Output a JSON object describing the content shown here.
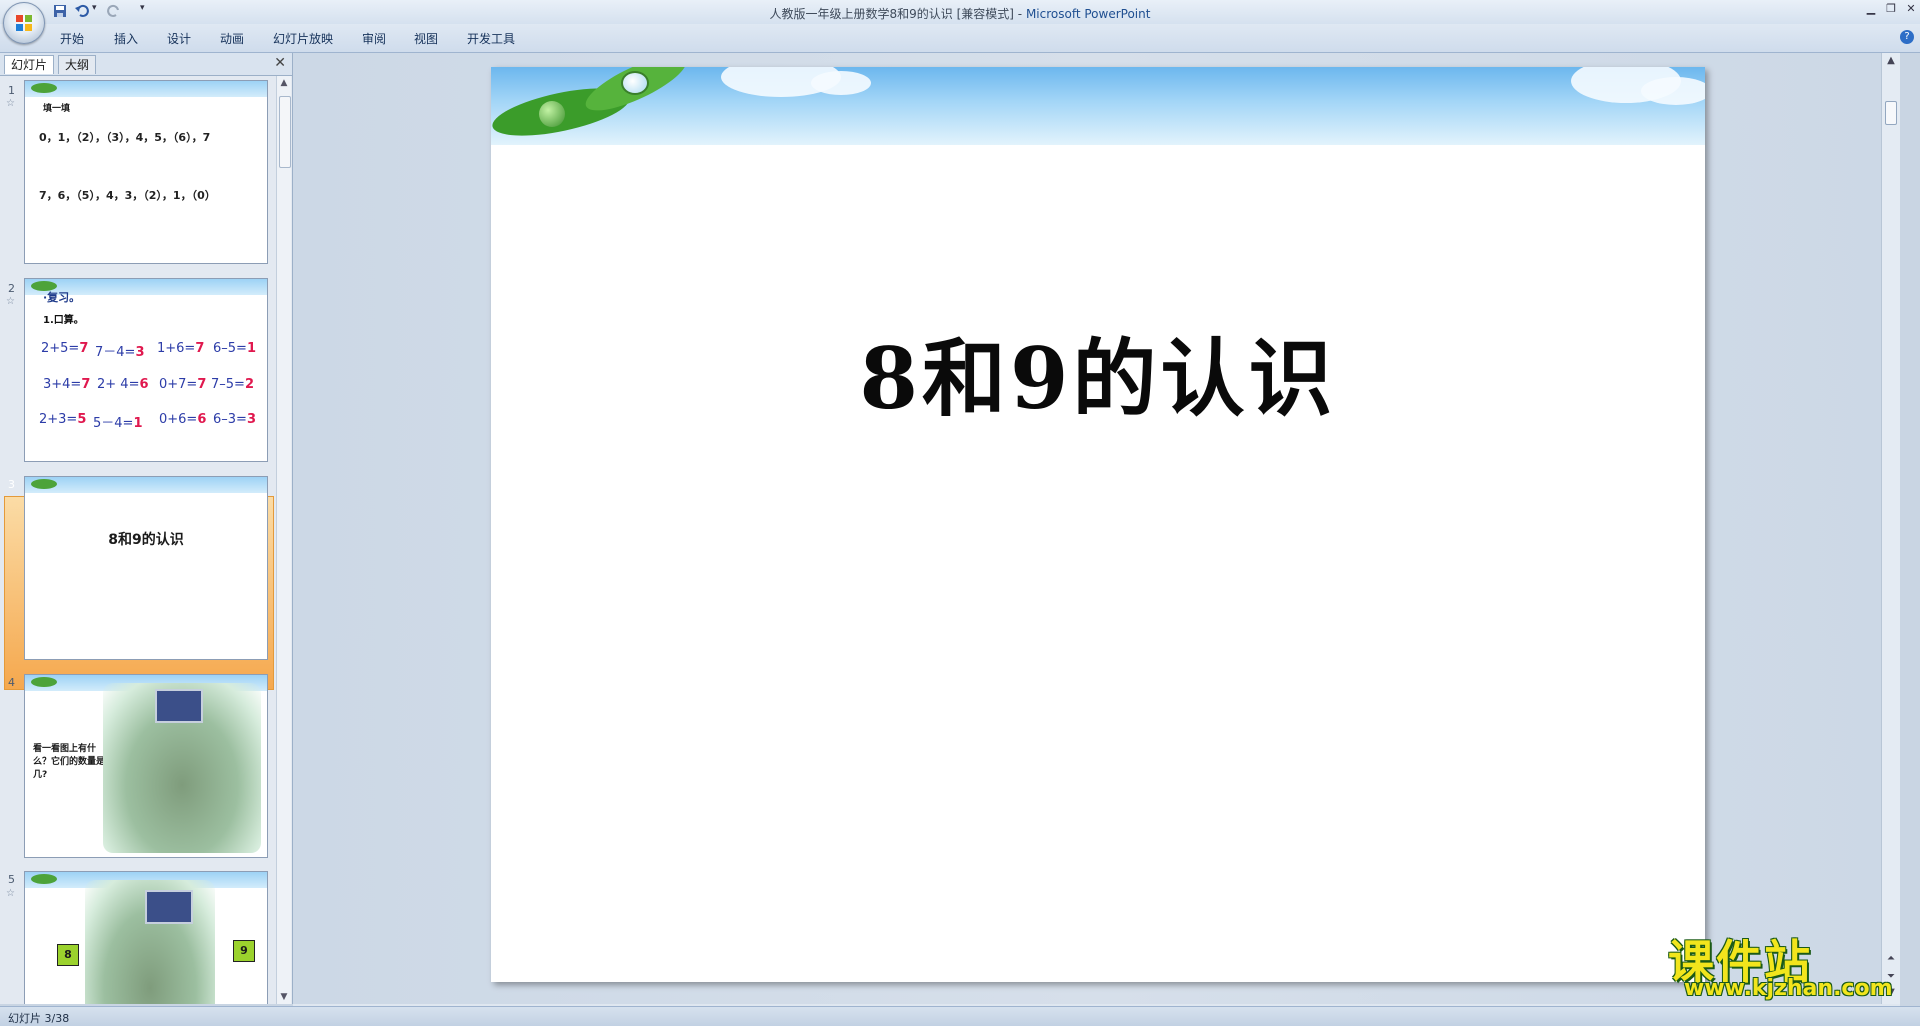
{
  "window": {
    "title": "人教版一年级上册数学8和9的认识 [兼容模式]",
    "app_name": "Microsoft PowerPoint",
    "separator": " - "
  },
  "ribbon": {
    "tabs": [
      "开始",
      "插入",
      "设计",
      "动画",
      "幻灯片放映",
      "审阅",
      "视图",
      "开发工具"
    ]
  },
  "left_pane": {
    "tab_slides": "幻灯片",
    "tab_outline": "大纲",
    "close_glyph": "✕",
    "selected_slide": 3,
    "slides": [
      {
        "num": "1",
        "heading": "填一填",
        "lines": [
          "0，1，（2），（3），4，5，（6），7",
          "7，6，（5），4，3，（2），1，（0）"
        ]
      },
      {
        "num": "2",
        "heading": "·复习。",
        "subheading": "1.口算。",
        "rows": [
          [
            [
              "2+5=",
              "7"
            ],
            [
              "7－4=",
              "3"
            ],
            [
              "1+6=",
              "7"
            ],
            [
              "6–5=",
              "1"
            ]
          ],
          [
            [
              "3+4=",
              "7"
            ],
            [
              "2+ 4=",
              "6"
            ],
            [
              "0+7=",
              "7"
            ],
            [
              "7–5=",
              "2"
            ]
          ],
          [
            [
              "2+3=",
              "5"
            ],
            [
              "5－4=",
              "1"
            ],
            [
              "0+6=",
              "6"
            ],
            [
              "6–3=",
              "3"
            ]
          ]
        ]
      },
      {
        "num": "3",
        "title": "8和9的认识"
      },
      {
        "num": "4",
        "text": "看一看图上有什么？它们的数量是几?"
      },
      {
        "num": "5",
        "left_number": "8",
        "right_number": "9"
      }
    ]
  },
  "slide": {
    "title": "8和9的认识"
  },
  "status": {
    "text": "幻灯片 3/38"
  },
  "watermark": {
    "big": "课件站",
    "url": "www.kjzhan.com"
  },
  "colors": {
    "selection": "#f5a84e",
    "answer_red": "#e0184e",
    "formula_blue": "#2c3ca8",
    "watermark_yellow": "#f2e51c"
  },
  "icons": {
    "office_button": "office-logo-icon",
    "save": "save-icon",
    "undo": "undo-icon",
    "redo": "redo-icon",
    "help": "help-icon"
  }
}
